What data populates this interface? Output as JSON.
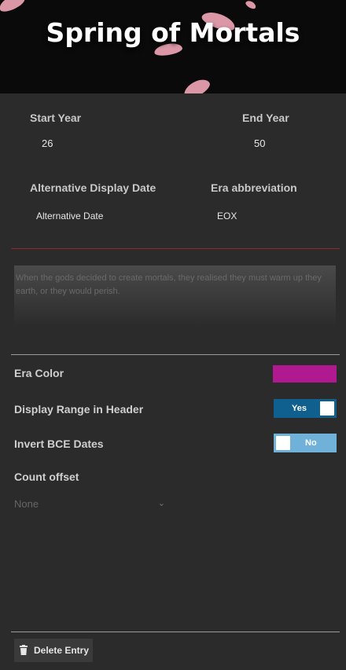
{
  "header": {
    "title": "Spring of Mortals"
  },
  "form": {
    "start_year_label": "Start Year",
    "start_year_value": "26",
    "end_year_label": "End Year",
    "end_year_value": "50",
    "alt_date_label": "Alternative Display Date",
    "alt_date_value": "Alternative Date",
    "era_abbr_label": "Era abbreviation",
    "era_abbr_value": "EOX",
    "description": "When the gods decided to create mortals, they realised they must warm up they earth, or they would perish."
  },
  "settings": {
    "era_color_label": "Era Color",
    "era_color": "#b0198f",
    "display_range_label": "Display Range in Header",
    "display_range_value": "Yes",
    "display_range_on": true,
    "invert_bce_label": "Invert BCE Dates",
    "invert_bce_value": "No",
    "invert_bce_on": false,
    "count_offset_label": "Count offset",
    "count_offset_value": "None"
  },
  "actions": {
    "delete_label": "Delete Entry"
  },
  "colors": {
    "accent_red": "#8a2a2a",
    "toggle_on": "#0f5f8f",
    "toggle_off": "#6fb1d8",
    "petal": "#f3a6b8"
  }
}
